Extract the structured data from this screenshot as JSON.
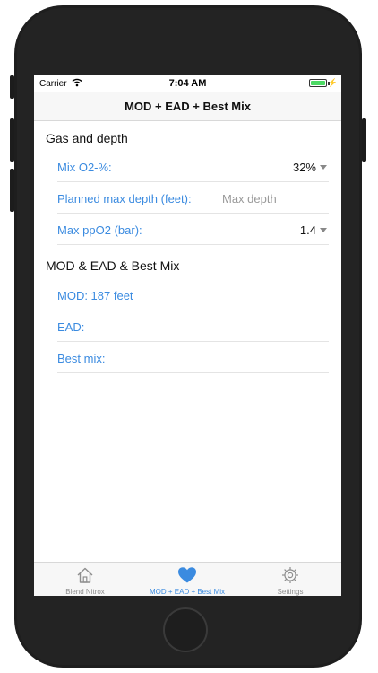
{
  "status_bar": {
    "carrier": "Carrier",
    "time": "7:04 AM"
  },
  "nav": {
    "title": "MOD + EAD + Best Mix"
  },
  "gas_section": {
    "header": "Gas and depth",
    "rows": [
      {
        "label": "Mix O2-%:",
        "value": "32%"
      },
      {
        "label": "Planned max depth (feet):",
        "placeholder": "Max depth"
      },
      {
        "label": "Max ppO2 (bar):",
        "value": "1.4"
      }
    ]
  },
  "results_section": {
    "header": "MOD & EAD & Best Mix",
    "rows": [
      {
        "label": "MOD: 187 feet"
      },
      {
        "label": "EAD:"
      },
      {
        "label": "Best mix:"
      }
    ]
  },
  "tabs": [
    {
      "label": "Blend Nitrox",
      "icon": "house-icon"
    },
    {
      "label": "MOD + EAD + Best Mix",
      "icon": "heart-icon",
      "active": true
    },
    {
      "label": "Settings",
      "icon": "gear-icon"
    }
  ],
  "colors": {
    "accent": "#3b8be0",
    "inactive": "#8e8e8e",
    "battery": "#4cd964"
  }
}
